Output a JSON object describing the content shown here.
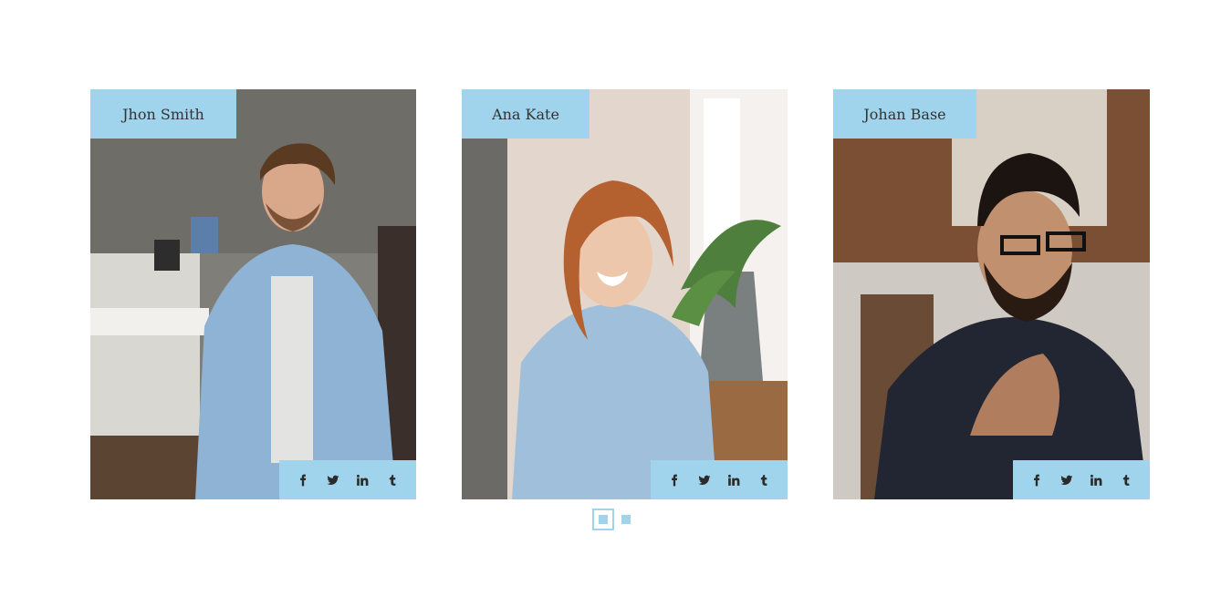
{
  "team": {
    "members": [
      {
        "name": "Jhon Smith"
      },
      {
        "name": "Ana Kate"
      },
      {
        "name": "Johan Base"
      }
    ],
    "social_icons": [
      "facebook-icon",
      "twitter-icon",
      "linkedin-icon",
      "tumblr-icon"
    ],
    "accent_color": "#9fd4ec"
  },
  "pagination": {
    "pages": 2,
    "active": 1
  }
}
